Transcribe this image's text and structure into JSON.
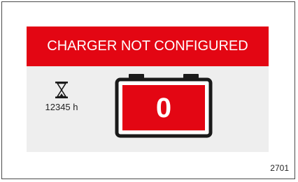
{
  "banner": {
    "text": "CHARGER NOT CONFIGURED",
    "color": "#e30613"
  },
  "timer": {
    "icon": "hourglass-icon",
    "hours_value": "12345 h"
  },
  "battery": {
    "icon": "battery-icon",
    "level_text": "0",
    "fill_color": "#e30613",
    "outline_color": "#1a1a1a"
  },
  "figure": {
    "number": "2701"
  },
  "colors": {
    "screen_background": "#eeeeee"
  }
}
